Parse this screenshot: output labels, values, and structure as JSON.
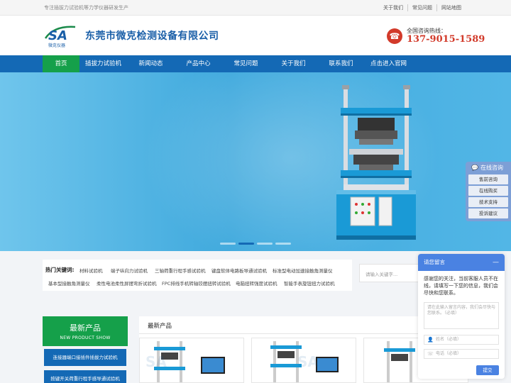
{
  "topbar": {
    "slogan": "专注插拔力试验机等力学仪器研发生产",
    "links": [
      "关于我们",
      "常见问题",
      "网站地图"
    ]
  },
  "header": {
    "logo_text": "SA",
    "logo_sub": "微克仪器",
    "company": "东莞市微克检测设备有限公司",
    "hotline_label": "全国咨询热线：",
    "hotline_number": "137-9015-1589"
  },
  "nav": {
    "items": [
      "首页",
      "插拔力试验机",
      "新闻动态",
      "产品中心",
      "常见问题",
      "关于我们",
      "联系我们",
      "点击进入官网"
    ],
    "active_index": 0
  },
  "banner": {
    "slides": 4,
    "active_slide": 2
  },
  "keywords": {
    "label": "热门关键词:",
    "row1": [
      "材料试验机",
      "端子纵向力试验机",
      "三轴荷重行程手感试验机",
      "键盘软体电路板导通试验机",
      "标准型电动加速接触角测量仪"
    ],
    "row2": [
      "基本型接触角测量仪",
      "柔性电池柔性屏摆弯折试验机",
      "FPC排线手机转轴铰摆扭转试验机",
      "电脑扭转强度试验机",
      "智能手表旋钮扭力试验机"
    ]
  },
  "search": {
    "placeholder": "请输入关键字..."
  },
  "category": {
    "title": "最新产品",
    "subtitle": "NEW PRODUCT SHOW",
    "items": [
      "连接器端口接插件插拔力试验机",
      "按键开关荷重行程手感导通试验机"
    ]
  },
  "products": {
    "title": "最新产品"
  },
  "side_float": {
    "title": "在线咨询",
    "buttons": [
      "售前咨询",
      "在线购买",
      "技术支持",
      "投诉建议"
    ]
  },
  "chat": {
    "title": "请您留言",
    "message": "感谢您的关注，当前客服人员不在线，请填写一下您的信息，我们会尽快和您联系。",
    "textarea_placeholder": "请在此输入留言内容，我们会尽快与您联系。（必填）",
    "name_placeholder": "姓名（必填）",
    "phone_placeholder": "电话（必填）",
    "send_label": "提交"
  },
  "colors": {
    "nav_blue": "#1469b5",
    "active_green": "#15a04a",
    "phone_red": "#d23a2a",
    "chat_blue": "#4a82e2"
  }
}
